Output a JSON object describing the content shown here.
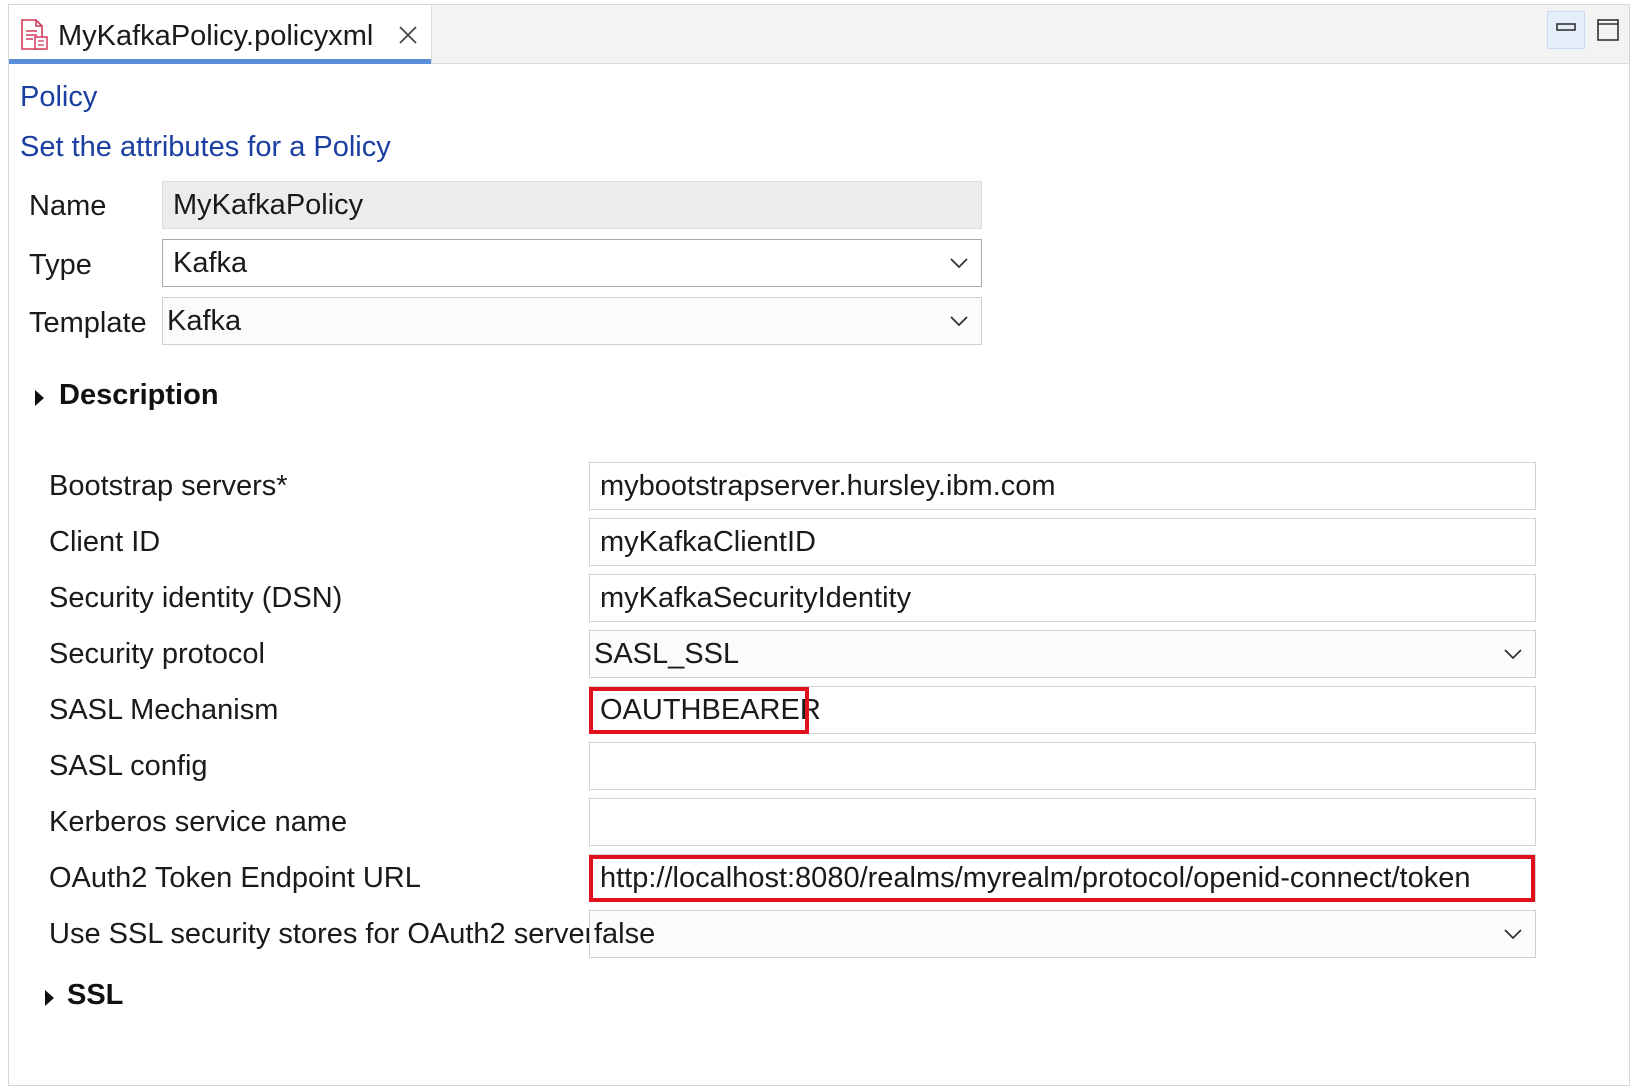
{
  "tab": {
    "title": "MyKafkaPolicy.policyxml",
    "icon": "policy-file-icon"
  },
  "window_controls": {
    "minimize_icon": "minimize-icon",
    "maximize_icon": "maximize-icon"
  },
  "page": {
    "heading": "Policy",
    "subheading": "Set the attributes for a Policy"
  },
  "general": {
    "name_label": "Name",
    "name_value": "MyKafkaPolicy",
    "type_label": "Type",
    "type_value": "Kafka",
    "template_label": "Template",
    "template_value": "Kafka"
  },
  "sections": {
    "description": "Description",
    "ssl": "SSL"
  },
  "properties": {
    "bootstrap_label": "Bootstrap servers*",
    "bootstrap_value": "mybootstrapserver.hursley.ibm.com",
    "client_id_label": "Client ID",
    "client_id_value": "myKafkaClientID",
    "security_identity_label": "Security identity (DSN)",
    "security_identity_value": "myKafkaSecurityIdentity",
    "security_protocol_label": "Security protocol",
    "security_protocol_value": "SASL_SSL",
    "sasl_mechanism_label": "SASL Mechanism",
    "sasl_mechanism_value": "OAUTHBEARER",
    "sasl_config_label": "SASL config",
    "sasl_config_value": "",
    "kerberos_label": "Kerberos service name",
    "kerberos_value": "",
    "oauth_url_label": "OAuth2 Token Endpoint URL",
    "oauth_url_value": "http://localhost:8080/realms/myrealm/protocol/openid-connect/token",
    "ssl_stores_label": "Use SSL security stores for OAuth2 server",
    "ssl_stores_value": "false"
  },
  "colors": {
    "heading": "#1b3fa0",
    "tab_accent": "#5a8fdc",
    "highlight": "#e0101c"
  }
}
